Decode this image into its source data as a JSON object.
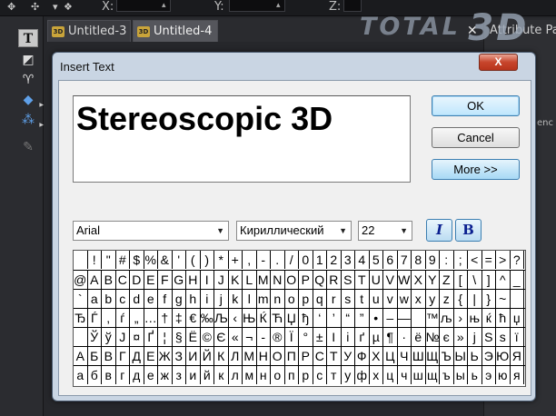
{
  "app": {
    "coords": [
      {
        "label": "X:"
      },
      {
        "label": "Y:"
      },
      {
        "label": "Z:"
      }
    ],
    "tabs": [
      {
        "label": "Untitled-3",
        "badge": "3D"
      },
      {
        "label": "Untitled-4",
        "badge": "3D",
        "active": true
      }
    ],
    "tab_close": "✕",
    "attribute_panel_title": "Attribute Pa",
    "attribute_panel_fragment": "enc",
    "tool_icons": [
      "text-tool-icon",
      "cube-tool-icon",
      "lathe-tool-icon",
      "diamond-tool-icon",
      "sphere-group-tool-icon",
      "edit-tool-icon"
    ],
    "logo": {
      "part1": "TOTAL",
      "part2": "3D"
    }
  },
  "dialog": {
    "title": "Insert Text",
    "close_label": "X",
    "preview_text": "Stereoscopic 3D",
    "buttons": {
      "ok": "OK",
      "cancel": "Cancel",
      "more": "More >>"
    },
    "font": {
      "value": "Arial"
    },
    "script": {
      "value": "Кириллический"
    },
    "size": {
      "value": "22"
    },
    "italic_label": "I",
    "bold_label": "B",
    "charmap": [
      [
        "",
        "!",
        "\"",
        "#",
        "$",
        "%",
        "&",
        "'",
        "(",
        ")",
        "*",
        "+",
        ",",
        "-",
        ".",
        "/",
        "0",
        "1",
        "2",
        "3",
        "4",
        "5",
        "6",
        "7",
        "8",
        "9",
        ":",
        ";",
        "<",
        "=",
        ">",
        "?"
      ],
      [
        "@",
        "A",
        "B",
        "C",
        "D",
        "E",
        "F",
        "G",
        "H",
        "I",
        "J",
        "K",
        "L",
        "M",
        "N",
        "O",
        "P",
        "Q",
        "R",
        "S",
        "T",
        "U",
        "V",
        "W",
        "X",
        "Y",
        "Z",
        "[",
        "\\",
        "]",
        "^",
        "_"
      ],
      [
        "`",
        "a",
        "b",
        "c",
        "d",
        "e",
        "f",
        "g",
        "h",
        "i",
        "j",
        "k",
        "l",
        "m",
        "n",
        "o",
        "p",
        "q",
        "r",
        "s",
        "t",
        "u",
        "v",
        "w",
        "x",
        "y",
        "z",
        "{",
        "|",
        "}",
        "~",
        ""
      ],
      [
        "Ђ",
        "Ѓ",
        ",",
        "ѓ",
        "„",
        "…",
        "†",
        "‡",
        "€",
        "‰",
        "Љ",
        "‹",
        "Њ",
        "Ќ",
        "Ћ",
        "Џ",
        "ђ",
        "‘",
        "’",
        "“",
        "”",
        "•",
        "–",
        "—",
        "",
        "™",
        "љ",
        "›",
        "њ",
        "ќ",
        "ћ",
        "џ"
      ],
      [
        "",
        "Ў",
        "ў",
        "Ј",
        "¤",
        "Ґ",
        "¦",
        "§",
        "Ё",
        "©",
        "Є",
        "«",
        "¬",
        "-",
        "®",
        "Ї",
        "°",
        "±",
        "І",
        "і",
        "ґ",
        "µ",
        "¶",
        "·",
        "ё",
        "№",
        "є",
        "»",
        "ј",
        "Ѕ",
        "ѕ",
        "ї"
      ],
      [
        "А",
        "Б",
        "В",
        "Г",
        "Д",
        "Е",
        "Ж",
        "З",
        "И",
        "Й",
        "К",
        "Л",
        "М",
        "Н",
        "О",
        "П",
        "Р",
        "С",
        "Т",
        "У",
        "Ф",
        "Х",
        "Ц",
        "Ч",
        "Ш",
        "Щ",
        "Ъ",
        "Ы",
        "Ь",
        "Э",
        "Ю",
        "Я"
      ],
      [
        "а",
        "б",
        "в",
        "г",
        "д",
        "е",
        "ж",
        "з",
        "и",
        "й",
        "к",
        "л",
        "м",
        "н",
        "о",
        "п",
        "р",
        "с",
        "т",
        "у",
        "ф",
        "х",
        "ц",
        "ч",
        "ш",
        "щ",
        "ъ",
        "ы",
        "ь",
        "э",
        "ю",
        "я"
      ]
    ]
  }
}
